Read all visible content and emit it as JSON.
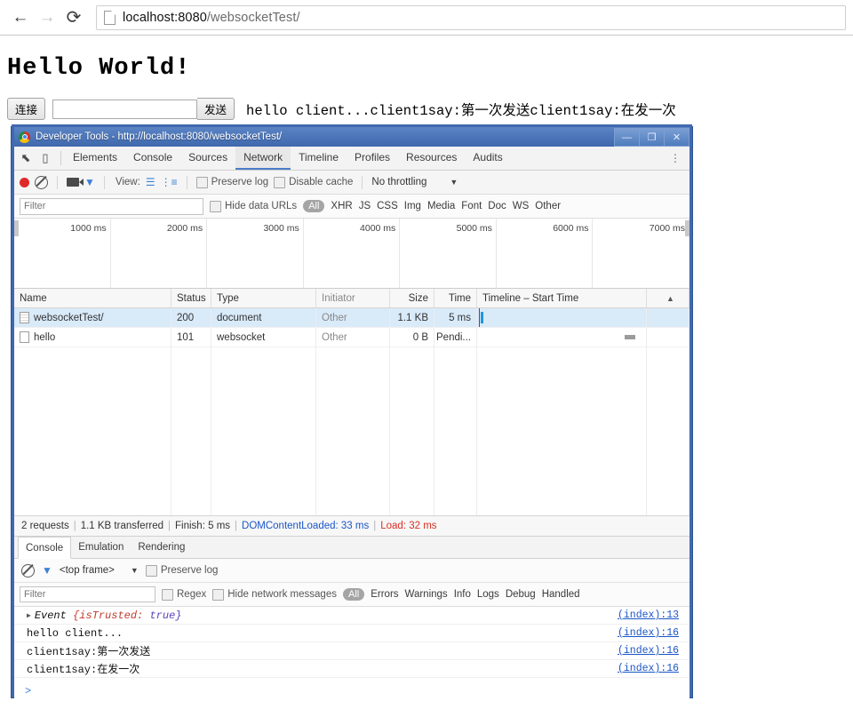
{
  "browser": {
    "back_icon": "arrow-left-icon",
    "forward_icon": "arrow-right-icon",
    "reload_icon": "reload-icon",
    "url_host": "localhost:8080",
    "url_path": "/websocketTest/"
  },
  "page": {
    "title": "Hello World!",
    "connect_button": "连接",
    "input_value": "",
    "input_placeholder": "",
    "send_button": "发送",
    "output_text": "hello client...client1say:第一次发送client1say:在发一次"
  },
  "devtools": {
    "window_title": "Developer Tools - http://localhost:8080/websocketTest/",
    "window_controls": {
      "minimize": "—",
      "maximize": "❐",
      "close": "✕"
    },
    "tabs": [
      {
        "label": "Elements",
        "active": false
      },
      {
        "label": "Console",
        "active": false
      },
      {
        "label": "Sources",
        "active": false
      },
      {
        "label": "Network",
        "active": true
      },
      {
        "label": "Timeline",
        "active": false
      },
      {
        "label": "Profiles",
        "active": false
      },
      {
        "label": "Resources",
        "active": false
      },
      {
        "label": "Audits",
        "active": false
      }
    ],
    "kebab": "⋮",
    "toolbar": {
      "record_icon": "record-icon",
      "clear_icon": "clear-icon",
      "capture_screenshots_icon": "camera-icon",
      "filter_icon": "funnel-icon",
      "view_label": "View:",
      "view_list_icon": "list-view-icon",
      "view_waterfall_icon": "waterfall-view-icon",
      "preserve_log": "Preserve log",
      "disable_cache": "Disable cache",
      "throttling": "No throttling",
      "throttling_caret": "▼"
    },
    "filterbar": {
      "filter_placeholder": "Filter",
      "filter_value": "",
      "hide_data_urls": "Hide data URLs",
      "types": [
        "All",
        "XHR",
        "JS",
        "CSS",
        "Img",
        "Media",
        "Font",
        "Doc",
        "WS",
        "Other"
      ],
      "active_type": "All"
    },
    "overview": {
      "ticks": [
        "1000 ms",
        "2000 ms",
        "3000 ms",
        "4000 ms",
        "5000 ms",
        "6000 ms",
        "7000 ms"
      ]
    },
    "table": {
      "columns": [
        "Name",
        "Status",
        "Type",
        "Initiator",
        "Size",
        "Time",
        "Timeline – Start Time"
      ],
      "sort_arrow": "▲",
      "rows": [
        {
          "name": "websocketTest/",
          "status": "200",
          "type": "document",
          "initiator": "Other",
          "size": "1.1 KB",
          "time": "5 ms",
          "selected": true
        },
        {
          "name": "hello",
          "status": "101",
          "type": "websocket",
          "initiator": "Other",
          "size": "0 B",
          "time": "Pendi...",
          "selected": false
        }
      ]
    },
    "status": {
      "requests": "2 requests",
      "transferred": "1.1 KB transferred",
      "finish": "Finish: 5 ms",
      "dom_content_loaded": "DOMContentLoaded: 33 ms",
      "load": "Load: 32 ms",
      "separator": "|"
    },
    "drawer": {
      "tabs": [
        {
          "label": "Console",
          "active": true
        },
        {
          "label": "Emulation",
          "active": false
        },
        {
          "label": "Rendering",
          "active": false
        }
      ],
      "clear_icon": "clear-icon",
      "filter_icon": "funnel-icon",
      "frame": "<top frame>",
      "frame_caret": "▼",
      "preserve_log": "Preserve log",
      "filter_placeholder": "Filter",
      "filter_value": "",
      "regex": "Regex",
      "hide_network_messages": "Hide network messages",
      "levels": [
        "All",
        "Errors",
        "Warnings",
        "Info",
        "Logs",
        "Debug",
        "Handled"
      ],
      "active_level": "All",
      "log": [
        {
          "expand": "▶",
          "text": "Event",
          "obj_key": "{isTrusted:",
          "obj_val": "true}",
          "source": "(index):13",
          "italic": true
        },
        {
          "expand": "",
          "text": "hello client...",
          "obj_key": "",
          "obj_val": "",
          "source": "(index):16",
          "italic": false
        },
        {
          "expand": "",
          "text": "client1say:第一次发送",
          "obj_key": "",
          "obj_val": "",
          "source": "(index):16",
          "italic": false
        },
        {
          "expand": "",
          "text": "client1say:在发一次",
          "obj_key": "",
          "obj_val": "",
          "source": "(index):16",
          "italic": false
        }
      ],
      "prompt": ">"
    }
  },
  "colors": {
    "titlebar_blue": "#4169b0",
    "accent_blue": "#3b82d6",
    "selected_row": "#d9eaf9",
    "dcl_marker": "#6a2fbb",
    "load_red": "#d93025",
    "link_blue": "#1a55c8",
    "record_red": "#e02a2a"
  }
}
